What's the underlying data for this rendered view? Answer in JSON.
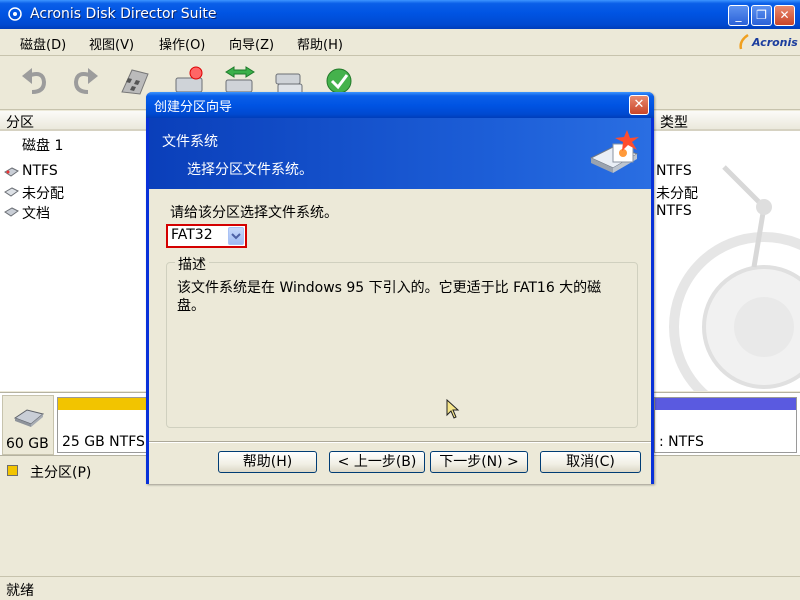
{
  "window": {
    "title": "Acronis Disk Director Suite"
  },
  "menu": {
    "items": [
      "磁盘(D)",
      "视图(V)",
      "操作(O)",
      "向导(Z)",
      "帮助(H)"
    ],
    "logo": "Acronis"
  },
  "toolbar": {
    "icons": [
      "undo-icon",
      "redo-icon",
      "commit-flag-icon",
      "create-partition-icon",
      "copy-partition-icon",
      "resize-partition-icon",
      "recovery-icon"
    ]
  },
  "left_panel": {
    "header": "分区",
    "disk_label": "磁盘 1",
    "rows": [
      "NTFS",
      "未分配",
      "文档"
    ]
  },
  "right_panel": {
    "header": "类型",
    "rows": [
      "NTFS",
      "未分配",
      "NTFS"
    ]
  },
  "disk_map": {
    "disk_size": "60 GB",
    "partitions": [
      {
        "label": "25 GB  NTFS",
        "color": "#f2c400"
      },
      {
        "label": ": NTFS",
        "color": "#5a5ae0"
      }
    ]
  },
  "legend": {
    "label": "主分区(P)",
    "color": "#f2c400"
  },
  "status": {
    "text": "就绪"
  },
  "dialog": {
    "title": "创建分区向导",
    "header_title": "文件系统",
    "header_subtitle": "选择分区文件系统。",
    "prompt": "请给该分区选择文件系统。",
    "filesystem": {
      "value": "FAT32"
    },
    "group_title": "描述",
    "description": "该文件系统是在 Windows 95 下引入的。它更适于比 FAT16 大的磁盘。",
    "buttons": {
      "help": "帮助(H)",
      "back": "< 上一步(B)",
      "next": "下一步(N) >",
      "cancel": "取消(C)"
    }
  },
  "colors": {
    "xp_blue": "#0054e3",
    "dialog_header": "#1d5fd8",
    "highlight_red": "#d40000",
    "primary_partition": "#f2c400"
  }
}
